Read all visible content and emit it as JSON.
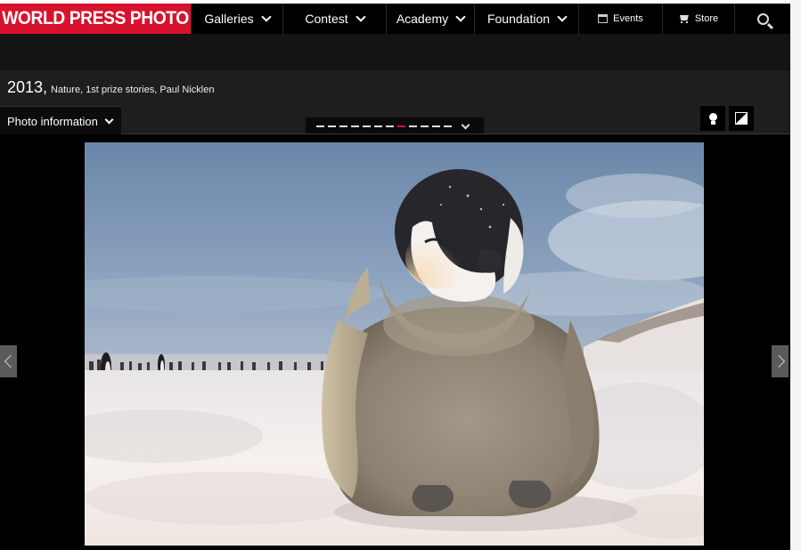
{
  "brand": {
    "logo_text": "WORLD PRESS PHOTO",
    "accent": "#d8112c"
  },
  "nav": {
    "items": [
      {
        "label": "Galleries"
      },
      {
        "label": "Contest"
      },
      {
        "label": "Academy"
      },
      {
        "label": "Foundation"
      }
    ],
    "events_label": "Events",
    "store_label": "Store",
    "icons": [
      "calendar-icon",
      "cart-icon",
      "search-icon"
    ]
  },
  "photo_header": {
    "year": "2013,",
    "details": "Nature, 1st prize stories, Paul Nicklen",
    "info_button": "Photo information"
  },
  "pager": {
    "total": 12,
    "current": 8
  },
  "tools": [
    "lightbulb-icon",
    "contrast-icon"
  ],
  "photo": {
    "subject": "emperor-penguin-chick"
  }
}
